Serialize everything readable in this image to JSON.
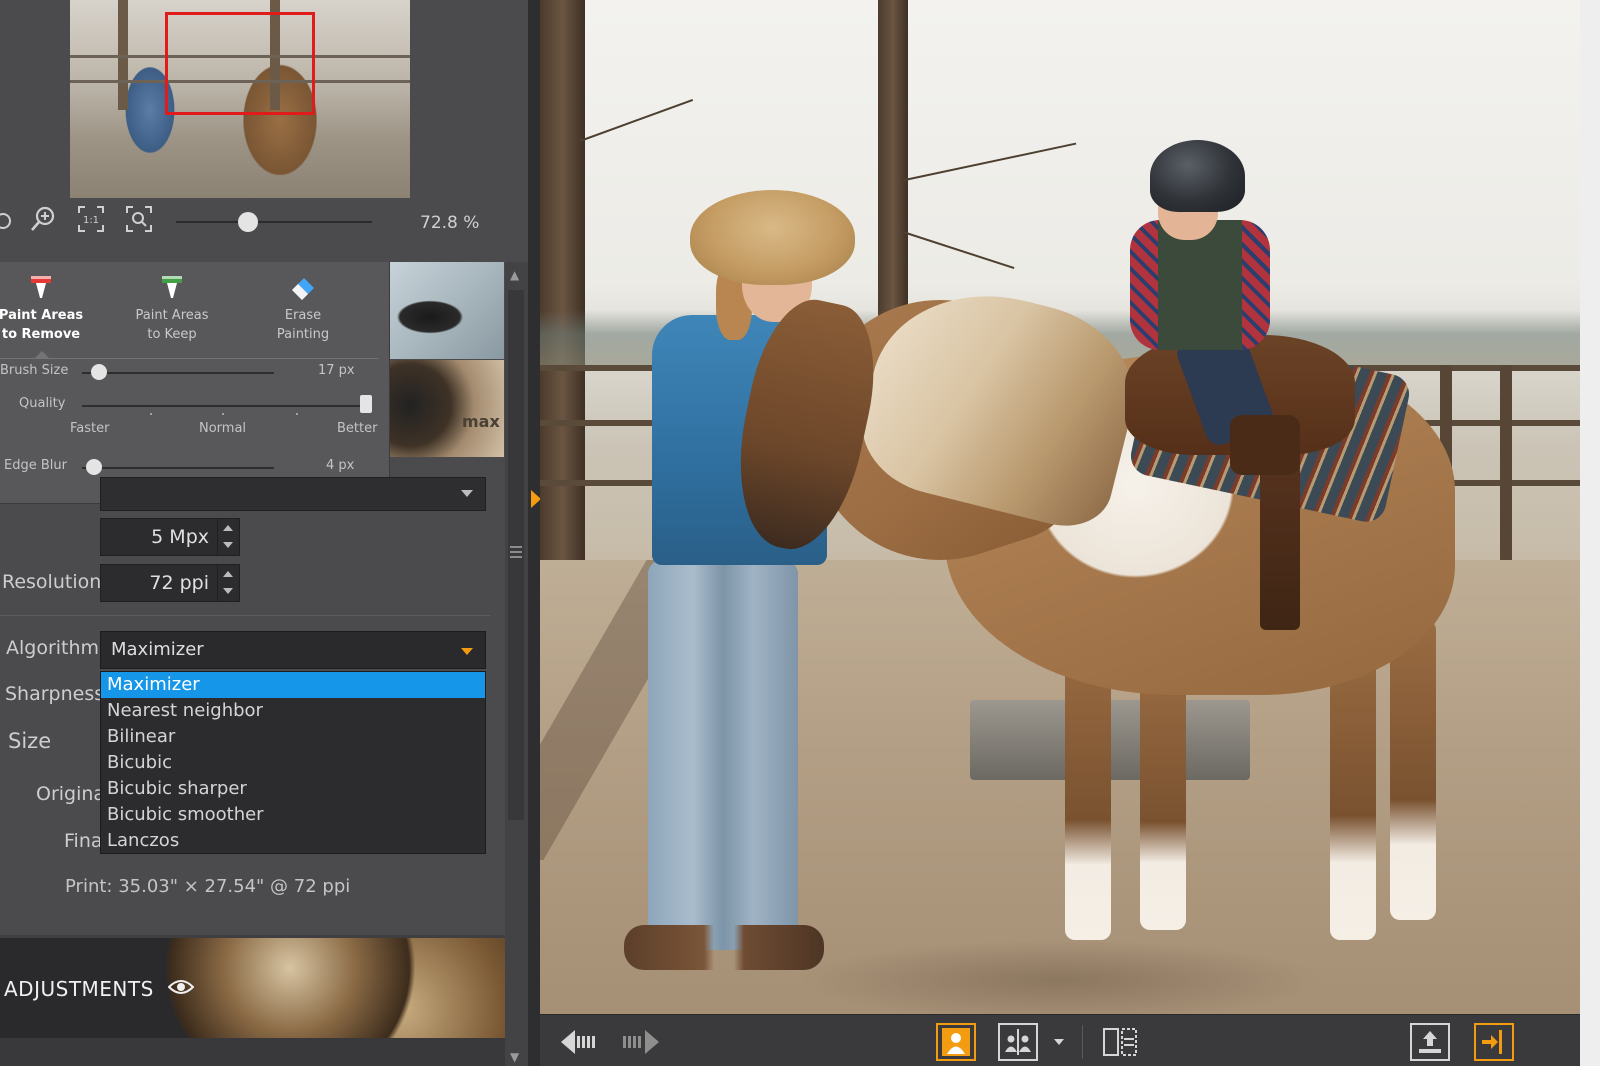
{
  "navigator": {
    "zoom_value": "72.8 %",
    "zoom_level_fraction": 0.35
  },
  "remove_tools": {
    "tools": [
      {
        "line1": "Paint Areas",
        "line2": "to Remove",
        "color": "#e53935"
      },
      {
        "line1": "Paint Areas",
        "line2": "to Keep",
        "color": "#43a047"
      },
      {
        "line1": "Erase",
        "line2": "Painting",
        "color": "#42a5f5"
      }
    ],
    "brush_size": {
      "label": "Brush Size",
      "value": "17 px",
      "fraction": 0.05
    },
    "quality": {
      "label": "Quality",
      "left": "Faster",
      "middle": "Normal",
      "right": "Better",
      "fraction": 1.0
    },
    "edge_blur": {
      "label": "Edge Blur",
      "value": "4 px",
      "fraction": 0.02
    }
  },
  "preset_thumbs": {
    "thumb2_label": "max"
  },
  "resize": {
    "size_value": "5 Mpx",
    "resolution_label": "Resolution",
    "resolution_value": "72 ppi",
    "algorithm_label": "Algorithm",
    "algorithm_value": "Maximizer",
    "sharpness_label": "Sharpness",
    "size_label": "Size",
    "original_label": "Origina",
    "final_label": "Fina",
    "algorithm_options": [
      "Maximizer",
      "Nearest neighbor",
      "Bilinear",
      "Bicubic",
      "Bicubic sharper",
      "Bicubic smoother",
      "Lanczos"
    ],
    "selected_option": "Maximizer",
    "print_info": "Print: 35.03\" × 27.54\" @ 72 ppi"
  },
  "adjustments": {
    "label": "ADJUSTMENTS"
  },
  "colors": {
    "accent": "#f39c12",
    "selection": "#1596e8",
    "navigator_frame": "#e01b1b"
  },
  "toolbar_icons": [
    "previous-image-icon",
    "next-image-icon",
    "single-person-view-icon",
    "compare-view-icon",
    "split-view-icon",
    "export-icon",
    "exit-icon"
  ]
}
